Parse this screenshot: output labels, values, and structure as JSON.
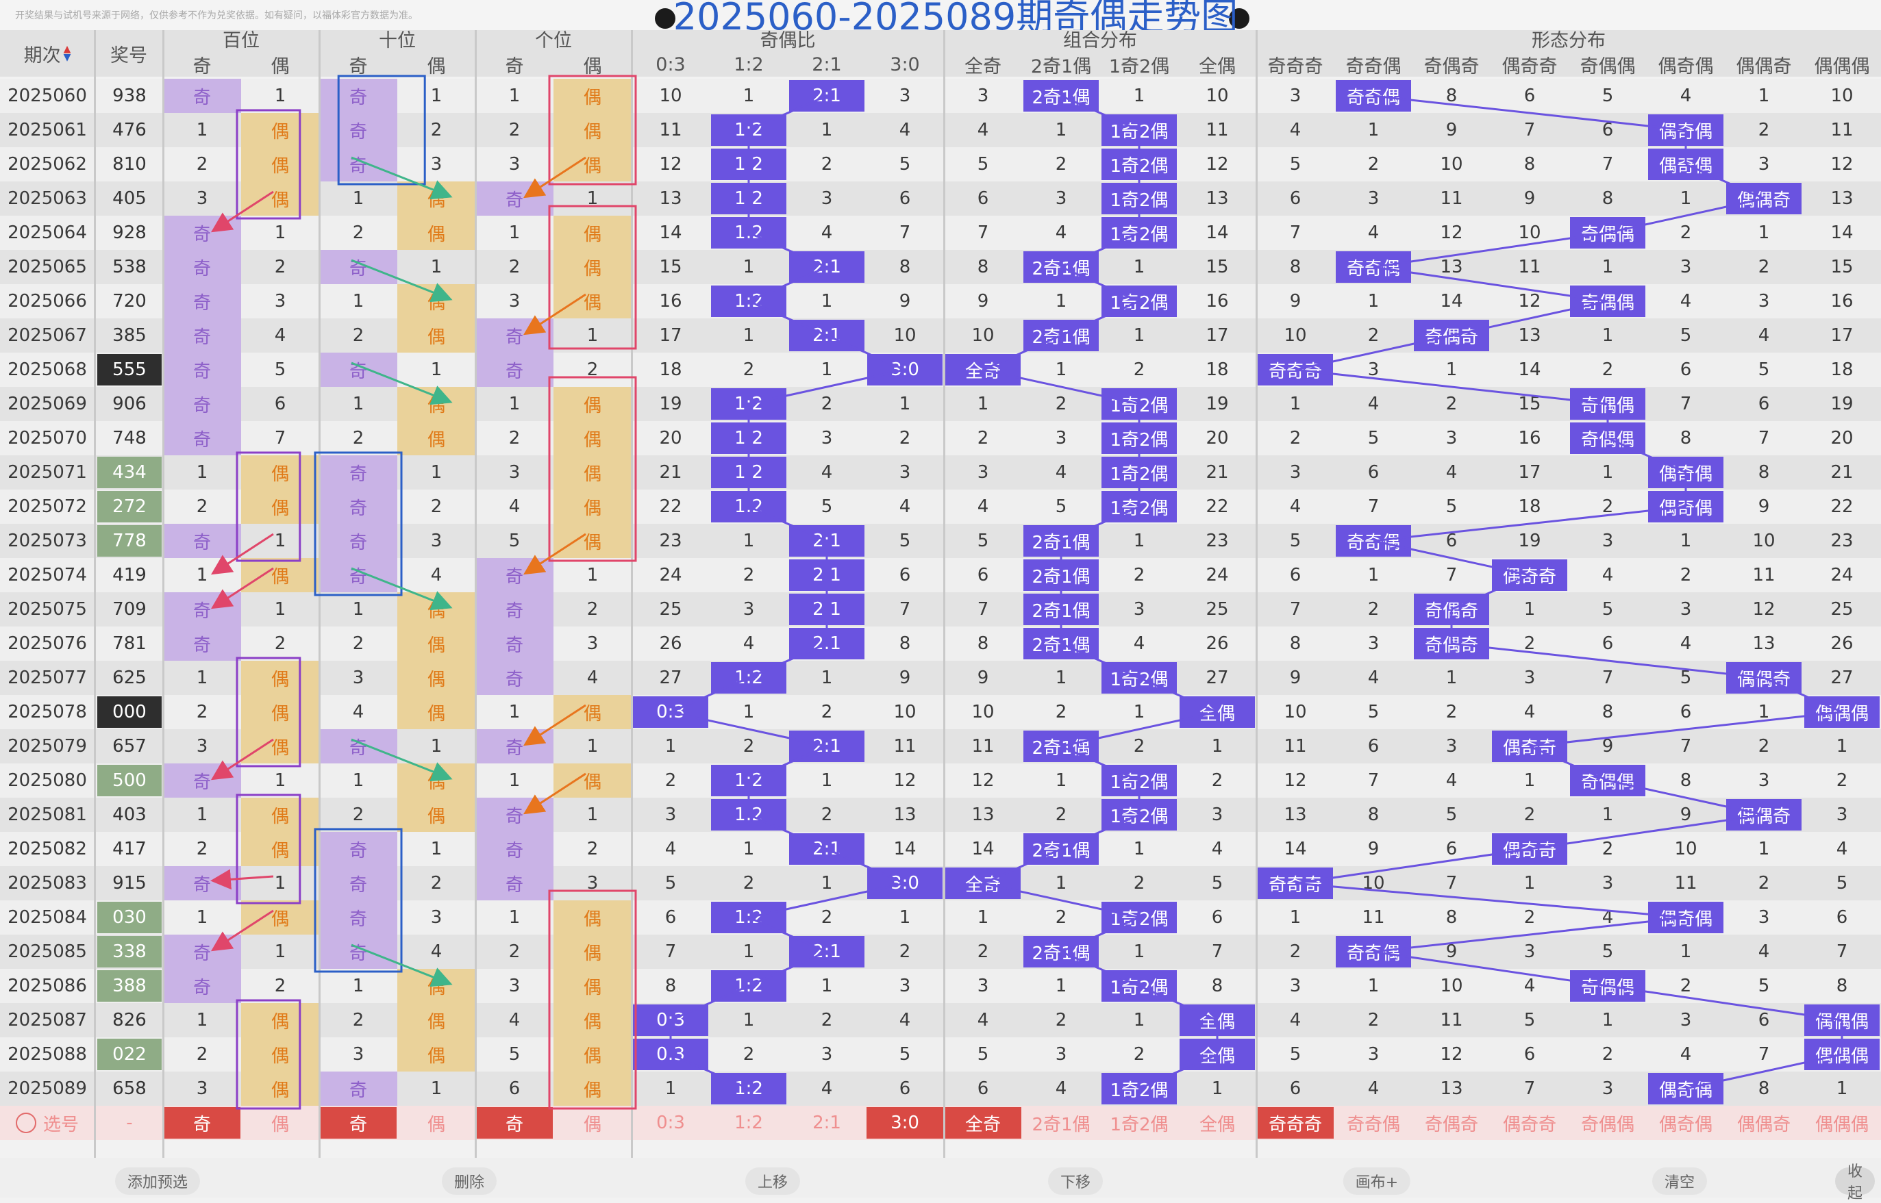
{
  "notice": "开奖结果与试机号来源于网络，仅供参考不作为兑奖依据。如有疑问，以福体彩官方数据为准。",
  "title": "2025060-2025089期奇偶走势图",
  "header": {
    "period": "期次",
    "sort_icon": "sort-arrows-icon",
    "number": "奖号",
    "groups": [
      "百位",
      "十位",
      "个位",
      "奇偶比",
      "组合分布",
      "形态分布"
    ],
    "sub": [
      "奇",
      "偶",
      "奇",
      "偶",
      "奇",
      "偶",
      "0:3",
      "1:2",
      "2:1",
      "3:0",
      "全奇",
      "2奇1偶",
      "1奇2偶",
      "全偶",
      "奇奇奇",
      "奇奇偶",
      "奇偶奇",
      "偶奇奇",
      "奇偶偶",
      "偶奇偶",
      "偶偶奇",
      "偶偶偶"
    ]
  },
  "rows": [
    {
      "p": "2025060",
      "n": "938",
      "h": "",
      "cells": [
        "奇",
        "1",
        "奇",
        "1",
        "1",
        "偶",
        "10",
        "1",
        "2:1",
        "3",
        "3",
        "2奇1偶",
        "1",
        "10",
        "3",
        "奇奇偶",
        "8",
        "6",
        "5",
        "4",
        "1",
        "10"
      ]
    },
    {
      "p": "2025061",
      "n": "476",
      "h": "",
      "cells": [
        "1",
        "偶",
        "奇",
        "2",
        "2",
        "偶",
        "11",
        "1:2",
        "1",
        "4",
        "4",
        "1",
        "1奇2偶",
        "11",
        "4",
        "1",
        "9",
        "7",
        "6",
        "偶奇偶",
        "2",
        "11"
      ]
    },
    {
      "p": "2025062",
      "n": "810",
      "h": "",
      "cells": [
        "2",
        "偶",
        "奇",
        "3",
        "3",
        "偶",
        "12",
        "1:2",
        "2",
        "5",
        "5",
        "2",
        "1奇2偶",
        "12",
        "5",
        "2",
        "10",
        "8",
        "7",
        "偶奇偶",
        "3",
        "12"
      ]
    },
    {
      "p": "2025063",
      "n": "405",
      "h": "",
      "cells": [
        "3",
        "偶",
        "1",
        "偶",
        "奇",
        "1",
        "13",
        "1:2",
        "3",
        "6",
        "6",
        "3",
        "1奇2偶",
        "13",
        "6",
        "3",
        "11",
        "9",
        "8",
        "1",
        "偶偶奇",
        "13"
      ]
    },
    {
      "p": "2025064",
      "n": "928",
      "h": "",
      "cells": [
        "奇",
        "1",
        "2",
        "偶",
        "1",
        "偶",
        "14",
        "1:2",
        "4",
        "7",
        "7",
        "4",
        "1奇2偶",
        "14",
        "7",
        "4",
        "12",
        "10",
        "奇偶偶",
        "2",
        "1",
        "14"
      ]
    },
    {
      "p": "2025065",
      "n": "538",
      "h": "",
      "cells": [
        "奇",
        "2",
        "奇",
        "1",
        "2",
        "偶",
        "15",
        "1",
        "2:1",
        "8",
        "8",
        "2奇1偶",
        "1",
        "15",
        "8",
        "奇奇偶",
        "13",
        "11",
        "1",
        "3",
        "2",
        "15"
      ]
    },
    {
      "p": "2025066",
      "n": "720",
      "h": "",
      "cells": [
        "奇",
        "3",
        "1",
        "偶",
        "3",
        "偶",
        "16",
        "1:2",
        "1",
        "9",
        "9",
        "1",
        "1奇2偶",
        "16",
        "9",
        "1",
        "14",
        "12",
        "奇偶偶",
        "4",
        "3",
        "16"
      ]
    },
    {
      "p": "2025067",
      "n": "385",
      "h": "",
      "cells": [
        "奇",
        "4",
        "2",
        "偶",
        "奇",
        "1",
        "17",
        "1",
        "2:1",
        "10",
        "10",
        "2奇1偶",
        "1",
        "17",
        "10",
        "2",
        "奇偶奇",
        "13",
        "1",
        "5",
        "4",
        "17"
      ]
    },
    {
      "p": "2025068",
      "n": "555",
      "h": "dark",
      "cells": [
        "奇",
        "5",
        "奇",
        "1",
        "奇",
        "2",
        "18",
        "2",
        "1",
        "3:0",
        "全奇",
        "1",
        "2",
        "18",
        "奇奇奇",
        "3",
        "1",
        "14",
        "2",
        "6",
        "5",
        "18"
      ]
    },
    {
      "p": "2025069",
      "n": "906",
      "h": "",
      "cells": [
        "奇",
        "6",
        "1",
        "偶",
        "1",
        "偶",
        "19",
        "1:2",
        "2",
        "1",
        "1",
        "2",
        "1奇2偶",
        "19",
        "1",
        "4",
        "2",
        "15",
        "奇偶偶",
        "7",
        "6",
        "19"
      ]
    },
    {
      "p": "2025070",
      "n": "748",
      "h": "",
      "cells": [
        "奇",
        "7",
        "2",
        "偶",
        "2",
        "偶",
        "20",
        "1:2",
        "3",
        "2",
        "2",
        "3",
        "1奇2偶",
        "20",
        "2",
        "5",
        "3",
        "16",
        "奇偶偶",
        "8",
        "7",
        "20"
      ]
    },
    {
      "p": "2025071",
      "n": "434",
      "h": "green",
      "cells": [
        "1",
        "偶",
        "奇",
        "1",
        "3",
        "偶",
        "21",
        "1:2",
        "4",
        "3",
        "3",
        "4",
        "1奇2偶",
        "21",
        "3",
        "6",
        "4",
        "17",
        "1",
        "偶奇偶",
        "8",
        "21"
      ]
    },
    {
      "p": "2025072",
      "n": "272",
      "h": "green",
      "cells": [
        "2",
        "偶",
        "奇",
        "2",
        "4",
        "偶",
        "22",
        "1:2",
        "5",
        "4",
        "4",
        "5",
        "1奇2偶",
        "22",
        "4",
        "7",
        "5",
        "18",
        "2",
        "偶奇偶",
        "9",
        "22"
      ]
    },
    {
      "p": "2025073",
      "n": "778",
      "h": "green",
      "cells": [
        "奇",
        "1",
        "奇",
        "3",
        "5",
        "偶",
        "23",
        "1",
        "2:1",
        "5",
        "5",
        "2奇1偶",
        "1",
        "23",
        "5",
        "奇奇偶",
        "6",
        "19",
        "3",
        "1",
        "10",
        "23"
      ]
    },
    {
      "p": "2025074",
      "n": "419",
      "h": "",
      "cells": [
        "1",
        "偶",
        "奇",
        "4",
        "奇",
        "1",
        "24",
        "2",
        "2:1",
        "6",
        "6",
        "2奇1偶",
        "2",
        "24",
        "6",
        "1",
        "7",
        "偶奇奇",
        "4",
        "2",
        "11",
        "24"
      ]
    },
    {
      "p": "2025075",
      "n": "709",
      "h": "",
      "cells": [
        "奇",
        "1",
        "1",
        "偶",
        "奇",
        "2",
        "25",
        "3",
        "2:1",
        "7",
        "7",
        "2奇1偶",
        "3",
        "25",
        "7",
        "2",
        "奇偶奇",
        "1",
        "5",
        "3",
        "12",
        "25"
      ]
    },
    {
      "p": "2025076",
      "n": "781",
      "h": "",
      "cells": [
        "奇",
        "2",
        "2",
        "偶",
        "奇",
        "3",
        "26",
        "4",
        "2:1",
        "8",
        "8",
        "2奇1偶",
        "4",
        "26",
        "8",
        "3",
        "奇偶奇",
        "2",
        "6",
        "4",
        "13",
        "26"
      ]
    },
    {
      "p": "2025077",
      "n": "625",
      "h": "",
      "cells": [
        "1",
        "偶",
        "3",
        "偶",
        "奇",
        "4",
        "27",
        "1:2",
        "1",
        "9",
        "9",
        "1",
        "1奇2偶",
        "27",
        "9",
        "4",
        "1",
        "3",
        "7",
        "5",
        "偶偶奇",
        "27"
      ]
    },
    {
      "p": "2025078",
      "n": "000",
      "h": "dark",
      "cells": [
        "2",
        "偶",
        "4",
        "偶",
        "1",
        "偶",
        "0:3",
        "1",
        "2",
        "10",
        "10",
        "2",
        "1",
        "全偶",
        "10",
        "5",
        "2",
        "4",
        "8",
        "6",
        "1",
        "偶偶偶"
      ]
    },
    {
      "p": "2025079",
      "n": "657",
      "h": "",
      "cells": [
        "3",
        "偶",
        "奇",
        "1",
        "奇",
        "1",
        "1",
        "2",
        "2:1",
        "11",
        "11",
        "2奇1偶",
        "2",
        "1",
        "11",
        "6",
        "3",
        "偶奇奇",
        "9",
        "7",
        "2",
        "1"
      ]
    },
    {
      "p": "2025080",
      "n": "500",
      "h": "green",
      "cells": [
        "奇",
        "1",
        "1",
        "偶",
        "1",
        "偶",
        "2",
        "1:2",
        "1",
        "12",
        "12",
        "1",
        "1奇2偶",
        "2",
        "12",
        "7",
        "4",
        "1",
        "奇偶偶",
        "8",
        "3",
        "2"
      ]
    },
    {
      "p": "2025081",
      "n": "403",
      "h": "",
      "cells": [
        "1",
        "偶",
        "2",
        "偶",
        "奇",
        "1",
        "3",
        "1:2",
        "2",
        "13",
        "13",
        "2",
        "1奇2偶",
        "3",
        "13",
        "8",
        "5",
        "2",
        "1",
        "9",
        "偶偶奇",
        "3"
      ]
    },
    {
      "p": "2025082",
      "n": "417",
      "h": "",
      "cells": [
        "2",
        "偶",
        "奇",
        "1",
        "奇",
        "2",
        "4",
        "1",
        "2:1",
        "14",
        "14",
        "2奇1偶",
        "1",
        "4",
        "14",
        "9",
        "6",
        "偶奇奇",
        "2",
        "10",
        "1",
        "4"
      ]
    },
    {
      "p": "2025083",
      "n": "915",
      "h": "",
      "cells": [
        "奇",
        "1",
        "奇",
        "2",
        "奇",
        "3",
        "5",
        "2",
        "1",
        "3:0",
        "全奇",
        "1",
        "2",
        "5",
        "奇奇奇",
        "10",
        "7",
        "1",
        "3",
        "11",
        "2",
        "5"
      ]
    },
    {
      "p": "2025084",
      "n": "030",
      "h": "green",
      "cells": [
        "1",
        "偶",
        "奇",
        "3",
        "1",
        "偶",
        "6",
        "1:2",
        "2",
        "1",
        "1",
        "2",
        "1奇2偶",
        "6",
        "1",
        "11",
        "8",
        "2",
        "4",
        "偶奇偶",
        "3",
        "6"
      ]
    },
    {
      "p": "2025085",
      "n": "338",
      "h": "green",
      "cells": [
        "奇",
        "1",
        "奇",
        "4",
        "2",
        "偶",
        "7",
        "1",
        "2:1",
        "2",
        "2",
        "2奇1偶",
        "1",
        "7",
        "2",
        "奇奇偶",
        "9",
        "3",
        "5",
        "1",
        "4",
        "7"
      ]
    },
    {
      "p": "2025086",
      "n": "388",
      "h": "green",
      "cells": [
        "奇",
        "2",
        "1",
        "偶",
        "3",
        "偶",
        "8",
        "1:2",
        "1",
        "3",
        "3",
        "1",
        "1奇2偶",
        "8",
        "3",
        "1",
        "10",
        "4",
        "奇偶偶",
        "2",
        "5",
        "8"
      ]
    },
    {
      "p": "2025087",
      "n": "826",
      "h": "",
      "cells": [
        "1",
        "偶",
        "2",
        "偶",
        "4",
        "偶",
        "0:3",
        "1",
        "2",
        "4",
        "4",
        "2",
        "1",
        "全偶",
        "4",
        "2",
        "11",
        "5",
        "1",
        "3",
        "6",
        "偶偶偶"
      ]
    },
    {
      "p": "2025088",
      "n": "022",
      "h": "green",
      "cells": [
        "2",
        "偶",
        "3",
        "偶",
        "5",
        "偶",
        "0:3",
        "2",
        "3",
        "5",
        "5",
        "3",
        "2",
        "全偶",
        "5",
        "3",
        "12",
        "6",
        "2",
        "4",
        "7",
        "偶偶偶"
      ]
    },
    {
      "p": "2025089",
      "n": "658",
      "h": "",
      "cells": [
        "3",
        "偶",
        "奇",
        "1",
        "6",
        "偶",
        "1",
        "1:2",
        "4",
        "6",
        "6",
        "4",
        "1奇2偶",
        "1",
        "6",
        "4",
        "13",
        "7",
        "3",
        "偶奇偶",
        "8",
        "1"
      ]
    }
  ],
  "select_row": {
    "label": "选号",
    "number": "-",
    "cells": [
      "奇",
      "偶",
      "奇",
      "偶",
      "奇",
      "偶",
      "0:3",
      "1:2",
      "2:1",
      "3:0",
      "全奇",
      "2奇1偶",
      "1奇2偶",
      "全偶",
      "奇奇奇",
      "奇奇偶",
      "奇偶奇",
      "偶奇奇",
      "奇偶偶",
      "偶奇偶",
      "偶偶奇",
      "偶偶偶"
    ],
    "selected": [
      0,
      2,
      4,
      9,
      10,
      14
    ]
  },
  "buttons": [
    "添加预选",
    "删除",
    "上移",
    "下移",
    "画布+",
    "清空",
    "收起"
  ],
  "colors": {
    "odd_bg": "#c9b3e6",
    "even_bg": "#ead29a",
    "odd_text": "#8d5fc9",
    "even_text": "#e07a18",
    "stat_hit": "#6a53e0",
    "highlight_green": "#8fac86",
    "highlight_dark": "#2e2e2e",
    "select_red": "#d94a44",
    "select_text": "#ef8f8f",
    "title": "#2b5fc7"
  }
}
